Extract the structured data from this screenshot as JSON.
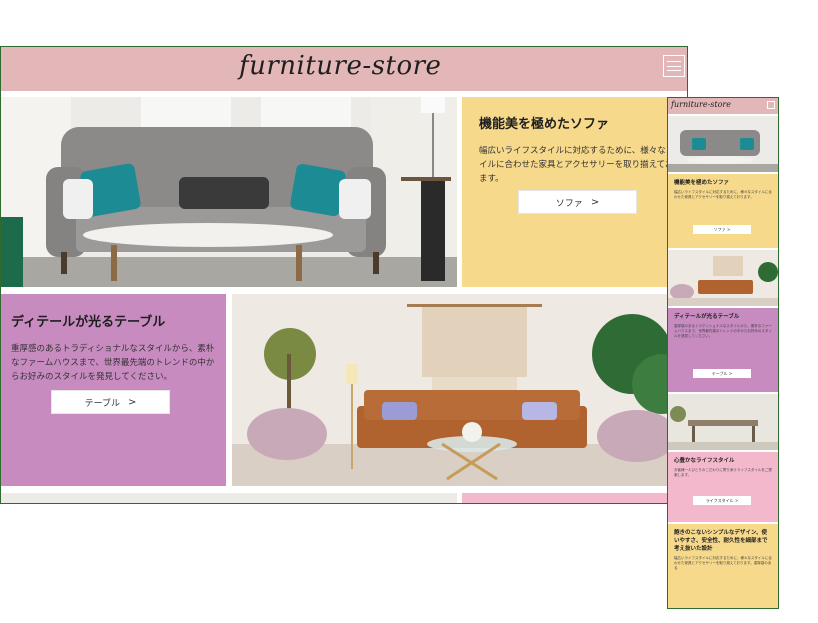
{
  "desktop": {
    "logo": "furniture-store",
    "sofa": {
      "title": "機能美を極めたソファ",
      "text": "幅広いライフスタイルに対応するために、様々なスタイルに合わせた家具とアクセサリーを取り揃えております。",
      "button": "ソファ"
    },
    "table": {
      "title": "ディテールが光るテーブル",
      "text": "重厚感のあるトラディショナルなスタイルから、素朴なファームハウスまで、世界最先端のトレンドの中からお好みのスタイルを発見してください。",
      "button": "テーブル"
    }
  },
  "mobile": {
    "logo": "furniture-store",
    "sofa": {
      "title": "機能美を極めたソファ",
      "text": "幅広いライフスタイルに対応するために、様々なスタイルに合わせた家具とアクセサリーを取り揃えております。",
      "button": "ソファ"
    },
    "table": {
      "title": "ディテールが光るテーブル",
      "text": "重厚感のあるトラディショナルなスタイルから、素朴なファームハウスまで、世界最先端のトレンドの中からお好みのスタイルを発見してください。",
      "button": "テーブル"
    },
    "lifestyle": {
      "title": "心豊かなライフスタイル",
      "text": "お客様一人ひとりのこだわりに寄り添うライフスタイルをご提案します。",
      "button": "ライフスタイル"
    },
    "design": {
      "title": "飽きのこないシンプルなデザイン、使いやすさ、安全性、耐久性を細部まで考え抜いた設計",
      "text": "幅広いライフスタイルに対応するために、様々なスタイルに合わせた家具とアクセサリーを取り揃えております。重厚感のある"
    }
  },
  "colors": {
    "header": "#e3b7b8",
    "yellow": "#f7d98c",
    "mauve": "#c78bc0",
    "pink": "#f3b8cc",
    "frame": "#2f6b2f"
  }
}
